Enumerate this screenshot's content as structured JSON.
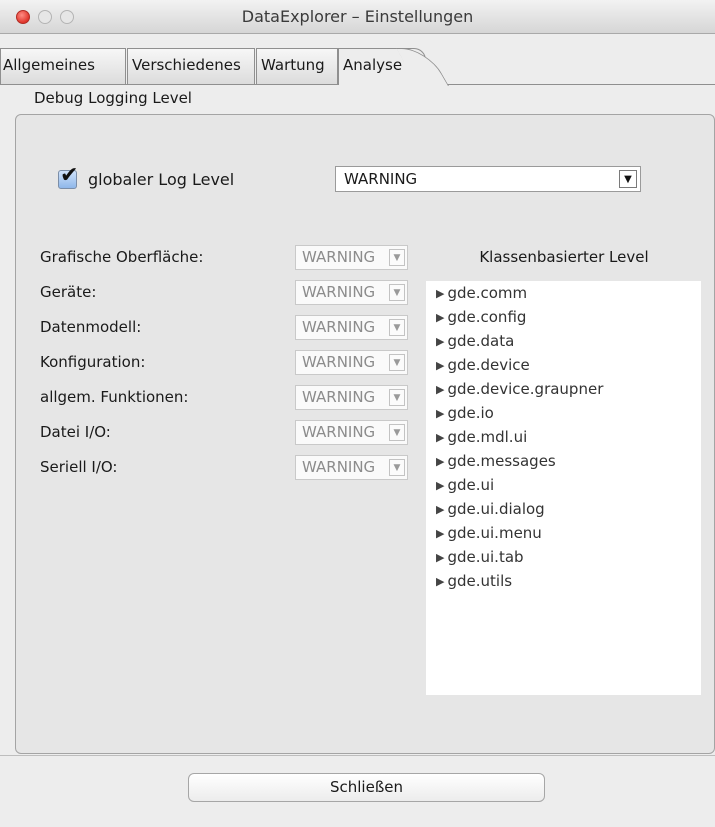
{
  "window": {
    "title": "DataExplorer – Einstellungen"
  },
  "tabs": [
    {
      "label": "Allgemeines"
    },
    {
      "label": "Verschiedenes"
    },
    {
      "label": "Wartung"
    },
    {
      "label": "Analyse",
      "active": true
    }
  ],
  "group": {
    "title": "Debug Logging Level"
  },
  "global": {
    "label": "globaler Log Level",
    "checked": true,
    "value": "WARNING"
  },
  "rows": [
    {
      "label": "Grafische Oberfläche:",
      "value": "WARNING"
    },
    {
      "label": "Geräte:",
      "value": "WARNING"
    },
    {
      "label": "Datenmodell:",
      "value": "WARNING"
    },
    {
      "label": "Konfiguration:",
      "value": "WARNING"
    },
    {
      "label": "allgem. Funktionen:",
      "value": "WARNING"
    },
    {
      "label": "Datei I/O:",
      "value": "WARNING"
    },
    {
      "label": "Seriell I/O:",
      "value": "WARNING"
    }
  ],
  "tree": {
    "title": "Klassenbasierter Level",
    "items": [
      "gde.comm",
      "gde.config",
      "gde.data",
      "gde.device",
      "gde.device.graupner",
      "gde.io",
      "gde.mdl.ui",
      "gde.messages",
      "gde.ui",
      "gde.ui.dialog",
      "gde.ui.menu",
      "gde.ui.tab",
      "gde.utils"
    ]
  },
  "buttons": {
    "close": "Schließen"
  },
  "icons": {
    "close": "close-icon",
    "minimize": "minimize-icon",
    "zoom": "zoom-icon",
    "dropdown": "chevron-down-icon",
    "expand": "triangle-right-icon"
  }
}
